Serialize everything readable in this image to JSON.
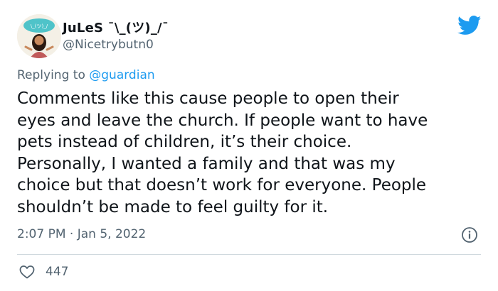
{
  "tweet": {
    "display_name": "JuLeS ¯\\_(ツ)_/¯",
    "handle": "@Nicetrybutn0",
    "replying_prefix": "Replying to ",
    "replying_to": "@guardian",
    "text_lines": [
      "Comments like this cause people to open their",
      "eyes and leave the church. If people want to have",
      "pets instead of children, it’s their choice.",
      "Personally, I wanted a family and that was my",
      "choice but that doesn’t work for everyone. People",
      "shouldn’t be made to feel guilty for it."
    ],
    "timestamp": "2:07 PM · Jan 5, 2022",
    "like_count": "447"
  },
  "icons": {
    "brand": "twitter-bird-icon",
    "info": "info-icon",
    "like": "heart-icon"
  },
  "colors": {
    "accent": "#1d9bf0",
    "text": "#0f1419",
    "secondary_text": "#536471",
    "divider": "#cfd9de"
  }
}
